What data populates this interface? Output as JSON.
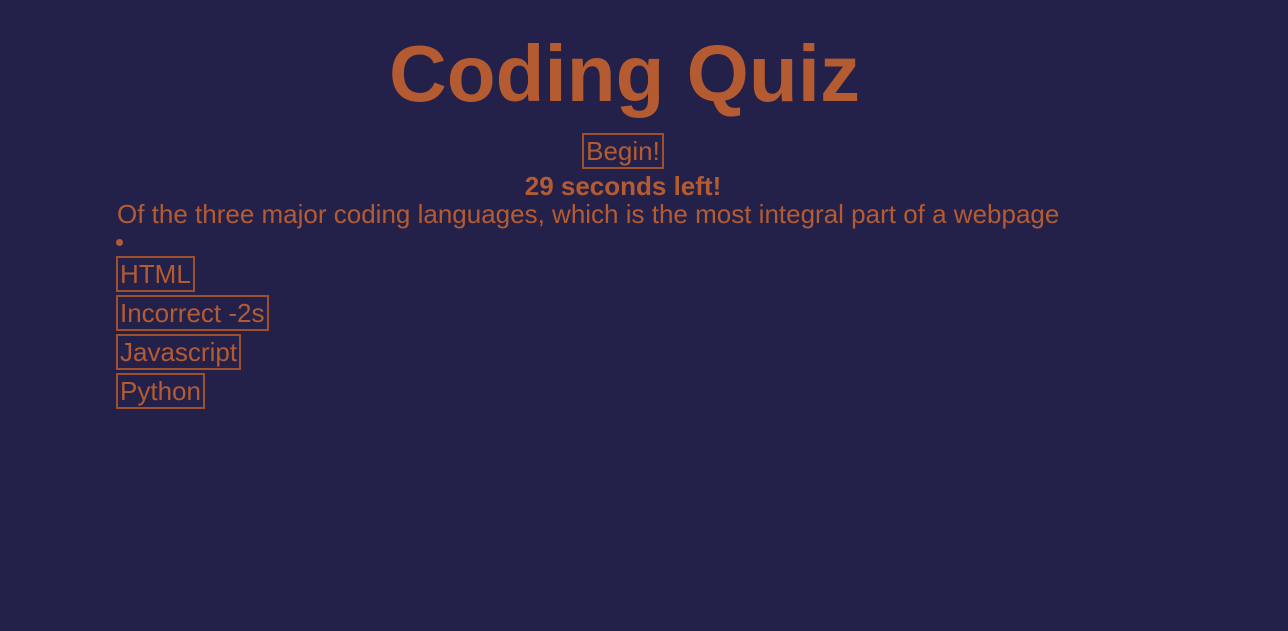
{
  "header": {
    "title": "Coding Quiz"
  },
  "controls": {
    "begin_label": "Begin!",
    "timer_text": "29 seconds left!"
  },
  "quiz": {
    "question": "Of the three major coding languages, which is the most integral part of a webpage",
    "answers": [
      {
        "label": "HTML"
      },
      {
        "label": "Incorrect -2s"
      },
      {
        "label": "Javascript"
      },
      {
        "label": "Python"
      }
    ]
  },
  "colors": {
    "background": "#23214a",
    "accent": "#b55b31",
    "border": "#9e4f2c"
  }
}
